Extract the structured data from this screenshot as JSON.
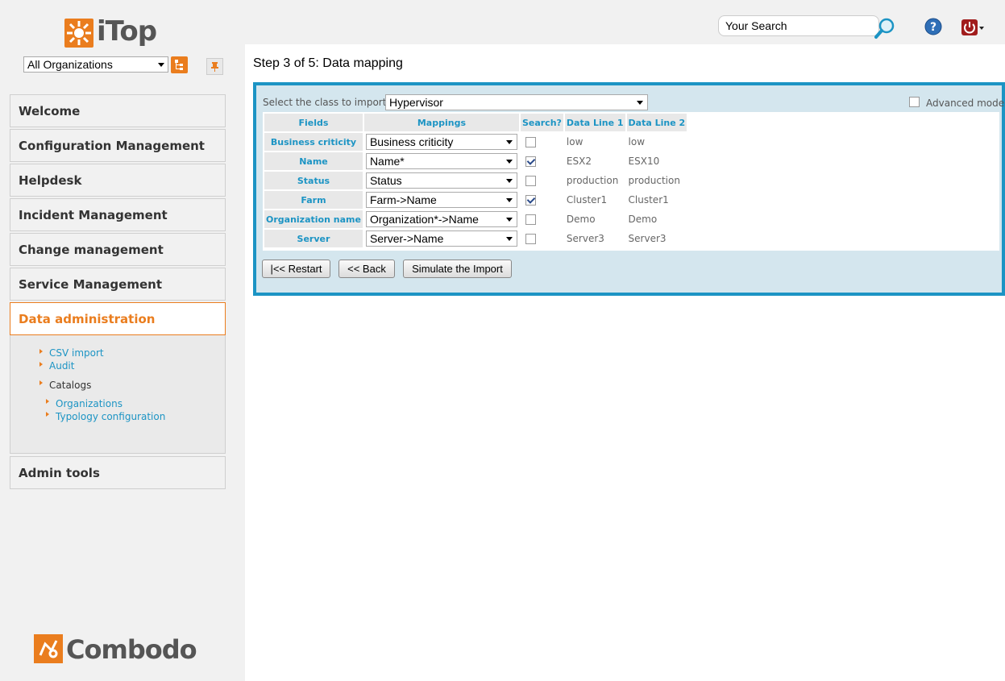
{
  "sidebar": {
    "logo_text": "iTop",
    "org_select": "All Organizations",
    "menu": [
      {
        "label": "Welcome"
      },
      {
        "label": "Configuration Management"
      },
      {
        "label": "Helpdesk"
      },
      {
        "label": "Incident Management"
      },
      {
        "label": "Change management"
      },
      {
        "label": "Service Management"
      },
      {
        "label": "Data administration",
        "active": true
      },
      {
        "label": "Admin tools"
      }
    ],
    "submenu": {
      "csv_import": "CSV import",
      "audit": "Audit",
      "catalogs": "Catalogs",
      "organizations": "Organizations",
      "typology": "Typology configuration"
    },
    "footer_logo_text": "Combodo"
  },
  "header": {
    "search_placeholder": "Your Search"
  },
  "main": {
    "title": "Step 3 of 5: Data mapping",
    "class_label": "Select the class to import:",
    "class_value": "Hypervisor",
    "advanced_mode_label": "Advanced mode",
    "table": {
      "headers": [
        "Fields",
        "Mappings",
        "Search?",
        "Data Line 1",
        "Data Line 2"
      ],
      "rows": [
        {
          "field": "Business criticity",
          "mapping": "Business criticity",
          "search": false,
          "line1": "low",
          "line2": "low"
        },
        {
          "field": "Name",
          "mapping": "Name*",
          "search": true,
          "line1": "ESX2",
          "line2": "ESX10"
        },
        {
          "field": "Status",
          "mapping": "Status",
          "search": false,
          "line1": "production",
          "line2": "production"
        },
        {
          "field": "Farm",
          "mapping": "Farm->Name",
          "search": true,
          "line1": "Cluster1",
          "line2": "Cluster1"
        },
        {
          "field": "Organization name",
          "mapping": "Organization*->Name",
          "search": false,
          "line1": "Demo",
          "line2": "Demo"
        },
        {
          "field": "Server",
          "mapping": "Server->Name",
          "search": false,
          "line1": "Server3",
          "line2": "Server3"
        }
      ]
    },
    "buttons": {
      "restart": "|<< Restart",
      "back": "<< Back",
      "simulate": "Simulate the Import"
    }
  },
  "colors": {
    "accent": "#ea7d1e",
    "link": "#1c94c4",
    "panel": "#d4e6ee"
  }
}
